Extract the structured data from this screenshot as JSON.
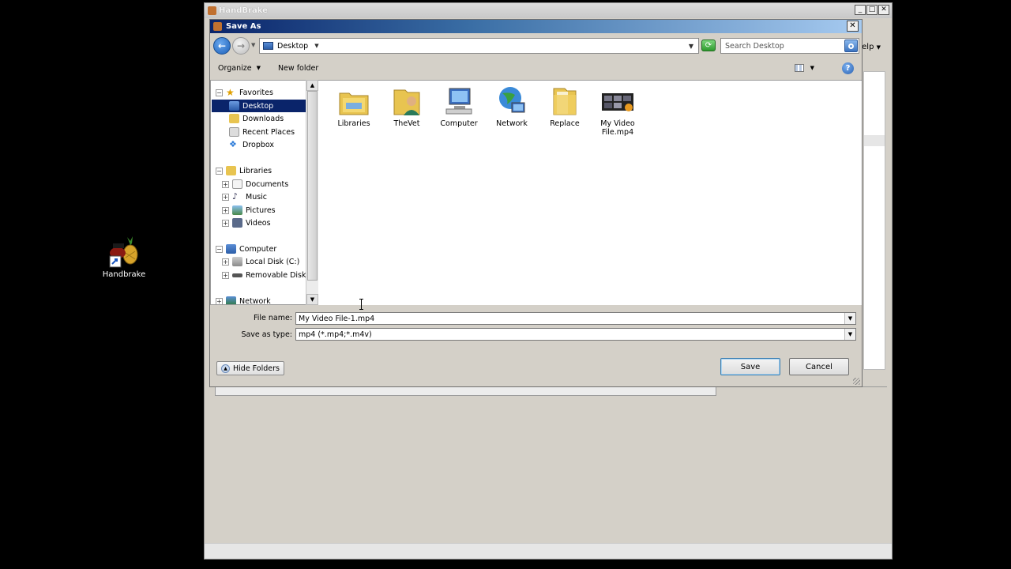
{
  "desktop": {
    "icon_label": "Handbrake"
  },
  "handbrake": {
    "title": "HandBrake",
    "menu_help_partial": "elp"
  },
  "dialog": {
    "title": "Save As",
    "address": "Desktop",
    "search_placeholder": "Search Desktop",
    "toolbar": {
      "organize": "Organize",
      "new_folder": "New folder"
    },
    "nav": {
      "favorites": "Favorites",
      "desktop": "Desktop",
      "downloads": "Downloads",
      "recent_places": "Recent Places",
      "dropbox": "Dropbox",
      "libraries": "Libraries",
      "documents": "Documents",
      "music": "Music",
      "pictures": "Pictures",
      "videos": "Videos",
      "computer": "Computer",
      "local_disk": "Local Disk (C:)",
      "removable_disk": "Removable Disk (J:",
      "network": "Network"
    },
    "files": [
      {
        "name": "Libraries"
      },
      {
        "name": "TheVet"
      },
      {
        "name": "Computer"
      },
      {
        "name": "Network"
      },
      {
        "name": "Replace"
      },
      {
        "name_line1": "My Video",
        "name_line2": "File.mp4"
      }
    ],
    "file_name_label": "File name:",
    "file_name_value": "My Video File-1.mp4",
    "save_type_label": "Save as type:",
    "save_type_value": "mp4 (*.mp4;*.m4v)",
    "hide_folders": "Hide Folders",
    "save": "Save",
    "cancel": "Cancel"
  }
}
